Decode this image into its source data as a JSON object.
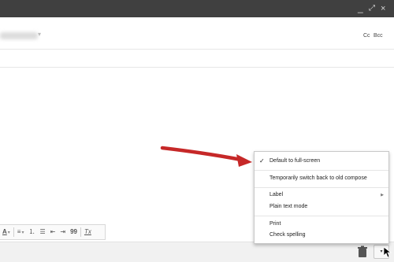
{
  "window": {
    "minimize_label": "_",
    "maximize_label": "⤢",
    "close_label": "×",
    "titlebar_color": "#404040"
  },
  "compose": {
    "cc_label": "Cc",
    "bcc_label": "Bcc"
  },
  "format_toolbar": {
    "text_color_label": "A",
    "dropdown_glyph": "▾",
    "align_icon": "≡",
    "numbered_list_icon": "⒈",
    "bulleted_list_icon": "☰",
    "indent_less_icon": "⇤",
    "indent_more_icon": "⇥",
    "quote_label": "99",
    "remove_format_label": "Tx"
  },
  "bottom_bar": {
    "more_options_glyph": "▾",
    "delete_icon": "trash-icon"
  },
  "more_menu": {
    "items": [
      {
        "label": "Default to full-screen",
        "checked": true
      },
      {
        "label": "Temporarily switch back to old compose"
      },
      {
        "label": "Label",
        "has_submenu": true
      },
      {
        "label": "Plain text mode"
      },
      {
        "label": "Print"
      },
      {
        "label": "Check spelling"
      }
    ],
    "check_glyph": "✓",
    "submenu_glyph": "▶"
  },
  "annotation": {
    "arrow_color": "#c62828"
  }
}
